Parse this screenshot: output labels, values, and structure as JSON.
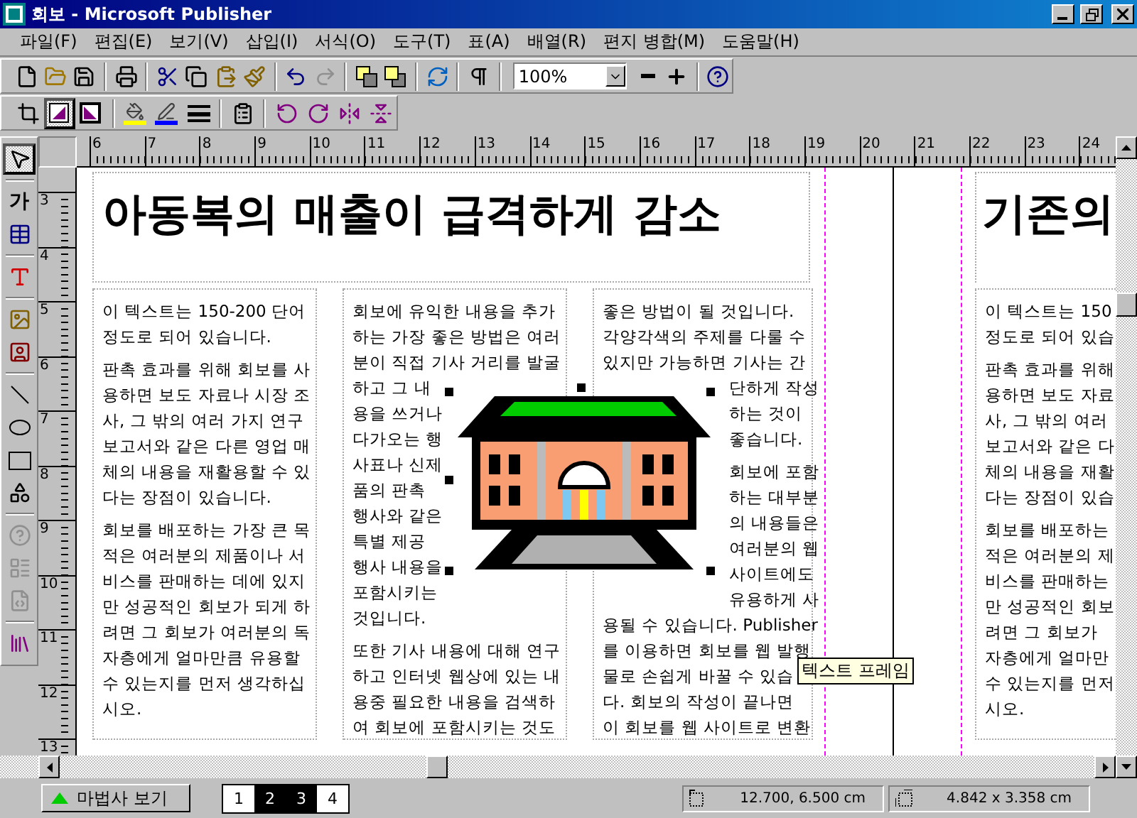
{
  "window": {
    "title": "회보 - Microsoft Publisher"
  },
  "menu": [
    "파일(F)",
    "편집(E)",
    "보기(V)",
    "삽입(I)",
    "서식(O)",
    "도구(T)",
    "표(A)",
    "배열(R)",
    "편지 병합(M)",
    "도움말(H)"
  ],
  "standard_toolbar": {
    "zoom": "100%",
    "redo_enabled": false
  },
  "formatting_toolbar": {
    "shadow_pressed": true
  },
  "objects_toolbar": {
    "text_tool": "가",
    "pointer_selected": true,
    "web_tools_enabled": false
  },
  "rulers": {
    "horizontal": [
      "6",
      "7",
      "8",
      "9",
      "10",
      "11",
      "12",
      "13",
      "14",
      "15",
      "16",
      "17",
      "18",
      "19",
      "20",
      "21",
      "22",
      "23",
      "24"
    ],
    "vertical": [
      "3",
      "4",
      "5",
      "6",
      "7",
      "8",
      "9",
      "10",
      "11",
      "12",
      "13"
    ]
  },
  "publication": {
    "headline": "아동복의 매출이 급격하게 감소",
    "columns": [
      {
        "paragraphs": [
          {
            "segments": [
              {
                "kind": "full",
                "lines": [
                  "이 텍스트는 150-200 단어",
                  "정도로 되어 있습니다."
                ]
              }
            ]
          },
          {
            "segments": [
              {
                "kind": "full",
                "lines": [
                  "판촉 효과를 위해 회보를 사",
                  "용하면 보도 자료나 시장 조",
                  "사, 그 밖의 여러 가지 연구",
                  "보고서와 같은 다른 영업 매",
                  "체의 내용을 재활용할 수 있",
                  "다는 장점이 있습니다."
                ]
              }
            ]
          },
          {
            "segments": [
              {
                "kind": "full",
                "lines": [
                  "회보를 배포하는 가장 큰 목",
                  "적은 여러분의 제품이나 서",
                  "비스를 판매하는 데에 있지",
                  "만 성공적인 회보가 되게 하",
                  "려면 그 회보가 여러분의 독",
                  "자층에게 얼마만큼 유용할",
                  "수 있는지를 먼저 생각하십",
                  "시오."
                ]
              }
            ]
          }
        ]
      },
      {
        "paragraphs": [
          {
            "segments": [
              {
                "kind": "full",
                "lines": [
                  "회보에 유익한 내용을 추가",
                  "하는 가장 좋은 방법은 여러",
                  "분이 직접 기사 거리를 발굴",
                  "하고 그 내",
                  "용을 쓰거나",
                  "다가오는 행",
                  "사표나 신제",
                  "품의 판촉",
                  "행사와 같은",
                  "특별 제공",
                  "행사 내용을",
                  "포함시키는",
                  "것입니다."
                ]
              }
            ]
          },
          {
            "segments": [
              {
                "kind": "full",
                "lines": [
                  "또한 기사 내용에 대해 연구",
                  "하고 인터넷 웹상에 있는 내",
                  "용중 필요한 내용을 검색하",
                  "여 회보에 포함시키는 것도"
                ]
              }
            ]
          }
        ]
      },
      {
        "paragraphs": [
          {
            "segments": [
              {
                "kind": "full",
                "lines": [
                  "좋은 방법이 될 것입니다.",
                  "각양각색의 주제를 다룰 수",
                  "있지만 가능하면 기사는 간"
                ]
              },
              {
                "kind": "wrapped",
                "lines": [
                  "단하게 작성",
                  "하는 것이",
                  "좋습니다."
                ]
              }
            ]
          },
          {
            "segments": [
              {
                "kind": "wrapped",
                "lines": [
                  "회보에 포함",
                  "하는 대부분",
                  "의 내용들은",
                  "여러분의 웹",
                  "사이트에도",
                  "유용하게 사"
                ]
              },
              {
                "kind": "full",
                "lines": [
                  "용될 수 있습니다. Publisher",
                  "를 이용하면 회보를 웹 발행",
                  "물로 손쉽게 바꿀 수 있습",
                  "다. 회보의 작성이 끝나면",
                  "이 회보를 웹 사이트로 변환"
                ]
              }
            ]
          }
        ]
      }
    ],
    "right_page": {
      "headline": "기존의",
      "paragraphs": [
        {
          "segments": [
            {
              "kind": "full",
              "lines": [
                "이 텍스트는 150",
                "정도로 되어 있습"
              ]
            }
          ]
        },
        {
          "segments": [
            {
              "kind": "full",
              "lines": [
                "판촉 효과를 위해",
                "용하면 보도 자료",
                "사, 그 밖의 여러",
                "보고서와 같은 다",
                "체의 내용을 재활",
                "다는 장점이 있습"
              ]
            }
          ]
        },
        {
          "segments": [
            {
              "kind": "full",
              "lines": [
                "회보를 배포하는",
                "적은 여러분의 제",
                "비스를 판매하는",
                "만 성공적인 회보",
                "려면 그 회보가",
                "자층에게 얼마만",
                "수 있는지를 먼저",
                "시오."
              ]
            }
          ]
        }
      ]
    }
  },
  "tooltip": "텍스트 프레임",
  "status_bar": {
    "wizard_button": "마법사 보기",
    "pages": [
      {
        "label": "1",
        "selected": false
      },
      {
        "label": "2",
        "selected": true
      },
      {
        "label": "3",
        "selected": true
      },
      {
        "label": "4",
        "selected": false
      }
    ],
    "position": "12.700, 6.500 cm",
    "size": "4.842 x 3.358 cm"
  }
}
